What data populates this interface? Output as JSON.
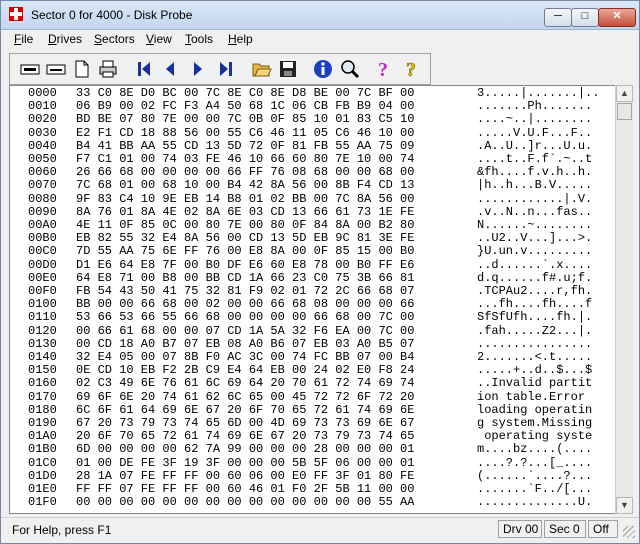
{
  "window": {
    "title": "Sector 0 for 4000 - Disk Probe",
    "min_glyph": "─",
    "max_glyph": "□",
    "close_glyph": "✕"
  },
  "menu": [
    {
      "label": "File",
      "acc": "F",
      "rest": "ile"
    },
    {
      "label": "Drives",
      "acc": "D",
      "rest": "rives"
    },
    {
      "label": "Sectors",
      "acc": "S",
      "rest": "ectors"
    },
    {
      "label": "View",
      "acc": "V",
      "rest": "iew"
    },
    {
      "label": "Tools",
      "acc": "T",
      "rest": "ools"
    },
    {
      "label": "Help",
      "acc": "H",
      "rest": "elp"
    }
  ],
  "toolbar_icons": [
    "read-sector-icon",
    "write-sector-icon",
    "open-document-icon",
    "print-icon",
    "first-sector-icon",
    "previous-sector-icon",
    "next-sector-icon",
    "last-sector-icon",
    "open-folder-icon",
    "save-icon",
    "info-icon",
    "find-icon",
    "help-icon",
    "context-help-icon"
  ],
  "hex_rows": [
    {
      "offset": "0000",
      "hex": "33 C0 8E D0 BC 00 7C 8E C0 8E D8 BE 00 7C BF 00",
      "ascii": "3.....|.......|.."
    },
    {
      "offset": "0010",
      "hex": "06 B9 00 02 FC F3 A4 50 68 1C 06 CB FB B9 04 00",
      "ascii": ".......Ph......."
    },
    {
      "offset": "0020",
      "hex": "BD BE 07 80 7E 00 00 7C 0B 0F 85 10 01 83 C5 10",
      "ascii": "....~..|........"
    },
    {
      "offset": "0030",
      "hex": "E2 F1 CD 18 88 56 00 55 C6 46 11 05 C6 46 10 00",
      "ascii": ".....V.U.F...F.."
    },
    {
      "offset": "0040",
      "hex": "B4 41 BB AA 55 CD 13 5D 72 0F 81 FB 55 AA 75 09",
      "ascii": ".A..U..]r...U.u."
    },
    {
      "offset": "0050",
      "hex": "F7 C1 01 00 74 03 FE 46 10 66 60 80 7E 10 00 74",
      "ascii": "....t..F.f`.~..t"
    },
    {
      "offset": "0060",
      "hex": "26 66 68 00 00 00 00 66 FF 76 08 68 00 00 68 00",
      "ascii": "&fh....f.v.h..h."
    },
    {
      "offset": "0070",
      "hex": "7C 68 01 00 68 10 00 B4 42 8A 56 00 8B F4 CD 13",
      "ascii": "|h..h...B.V....."
    },
    {
      "offset": "0080",
      "hex": "9F 83 C4 10 9E EB 14 B8 01 02 BB 00 7C 8A 56 00",
      "ascii": "............|.V."
    },
    {
      "offset": "0090",
      "hex": "8A 76 01 8A 4E 02 8A 6E 03 CD 13 66 61 73 1E FE",
      "ascii": ".v..N..n...fas.."
    },
    {
      "offset": "00A0",
      "hex": "4E 11 0F 85 0C 00 80 7E 00 80 0F 84 8A 00 B2 80",
      "ascii": "N......~........"
    },
    {
      "offset": "00B0",
      "hex": "EB 82 55 32 E4 8A 56 00 CD 13 5D EB 9C 81 3E FE",
      "ascii": "..U2..V...]...>."
    },
    {
      "offset": "00C0",
      "hex": "7D 55 AA 75 6E FF 76 00 E8 8A 00 0F 85 15 00 B0",
      "ascii": "}U.un.v........."
    },
    {
      "offset": "00D0",
      "hex": "D1 E6 64 E8 7F 00 B0 DF E6 60 E8 78 00 B0 FF E6",
      "ascii": "..d......`.x...."
    },
    {
      "offset": "00E0",
      "hex": "64 E8 71 00 B8 00 BB CD 1A 66 23 C0 75 3B 66 81",
      "ascii": "d.q......f#.u;f."
    },
    {
      "offset": "00F0",
      "hex": "FB 54 43 50 41 75 32 81 F9 02 01 72 2C 66 68 07",
      "ascii": ".TCPAu2....r,fh."
    },
    {
      "offset": "0100",
      "hex": "BB 00 00 66 68 00 02 00 00 66 68 08 00 00 00 66",
      "ascii": "...fh....fh....f"
    },
    {
      "offset": "0110",
      "hex": "53 66 53 66 55 66 68 00 00 00 00 66 68 00 7C 00",
      "ascii": "SfSfUfh....fh.|."
    },
    {
      "offset": "0120",
      "hex": "00 66 61 68 00 00 07 CD 1A 5A 32 F6 EA 00 7C 00",
      "ascii": ".fah.....Z2...|."
    },
    {
      "offset": "0130",
      "hex": "00 CD 18 A0 B7 07 EB 08 A0 B6 07 EB 03 A0 B5 07",
      "ascii": "................"
    },
    {
      "offset": "0140",
      "hex": "32 E4 05 00 07 8B F0 AC 3C 00 74 FC BB 07 00 B4",
      "ascii": "2.......<.t....."
    },
    {
      "offset": "0150",
      "hex": "0E CD 10 EB F2 2B C9 E4 64 EB 00 24 02 E0 F8 24",
      "ascii": ".....+..d..$...$"
    },
    {
      "offset": "0160",
      "hex": "02 C3 49 6E 76 61 6C 69 64 20 70 61 72 74 69 74",
      "ascii": "..Invalid partit"
    },
    {
      "offset": "0170",
      "hex": "69 6F 6E 20 74 61 62 6C 65 00 45 72 72 6F 72 20",
      "ascii": "ion table.Error "
    },
    {
      "offset": "0180",
      "hex": "6C 6F 61 64 69 6E 67 20 6F 70 65 72 61 74 69 6E",
      "ascii": "loading operatin"
    },
    {
      "offset": "0190",
      "hex": "67 20 73 79 73 74 65 6D 00 4D 69 73 73 69 6E 67",
      "ascii": "g system.Missing"
    },
    {
      "offset": "01A0",
      "hex": "20 6F 70 65 72 61 74 69 6E 67 20 73 79 73 74 65",
      "ascii": " operating syste"
    },
    {
      "offset": "01B0",
      "hex": "6D 00 00 00 00 62 7A 99 00 00 00 28 00 00 00 01",
      "ascii": "m....bz....(...."
    },
    {
      "offset": "01C0",
      "hex": "01 00 DE FE 3F 19 3F 00 00 00 5B 5F 06 00 00 01",
      "ascii": "....?.?...[_...."
    },
    {
      "offset": "01D0",
      "hex": "28 1A 07 FE FF FF 00 60 06 00 E0 FF 3F 01 80 FE",
      "ascii": "(......`....?..."
    },
    {
      "offset": "01E0",
      "hex": "FF FF 07 FE FF FF 00 60 46 01 F0 2F 5B 11 00 00",
      "ascii": ".......`F../[..."
    },
    {
      "offset": "01F0",
      "hex": "00 00 00 00 00 00 00 00 00 00 00 00 00 00 55 AA",
      "ascii": "..............U."
    }
  ],
  "status": {
    "help_text": "For Help, press F1",
    "drive": "Drv 00",
    "sector": "Sec 0",
    "mode": "Off"
  }
}
